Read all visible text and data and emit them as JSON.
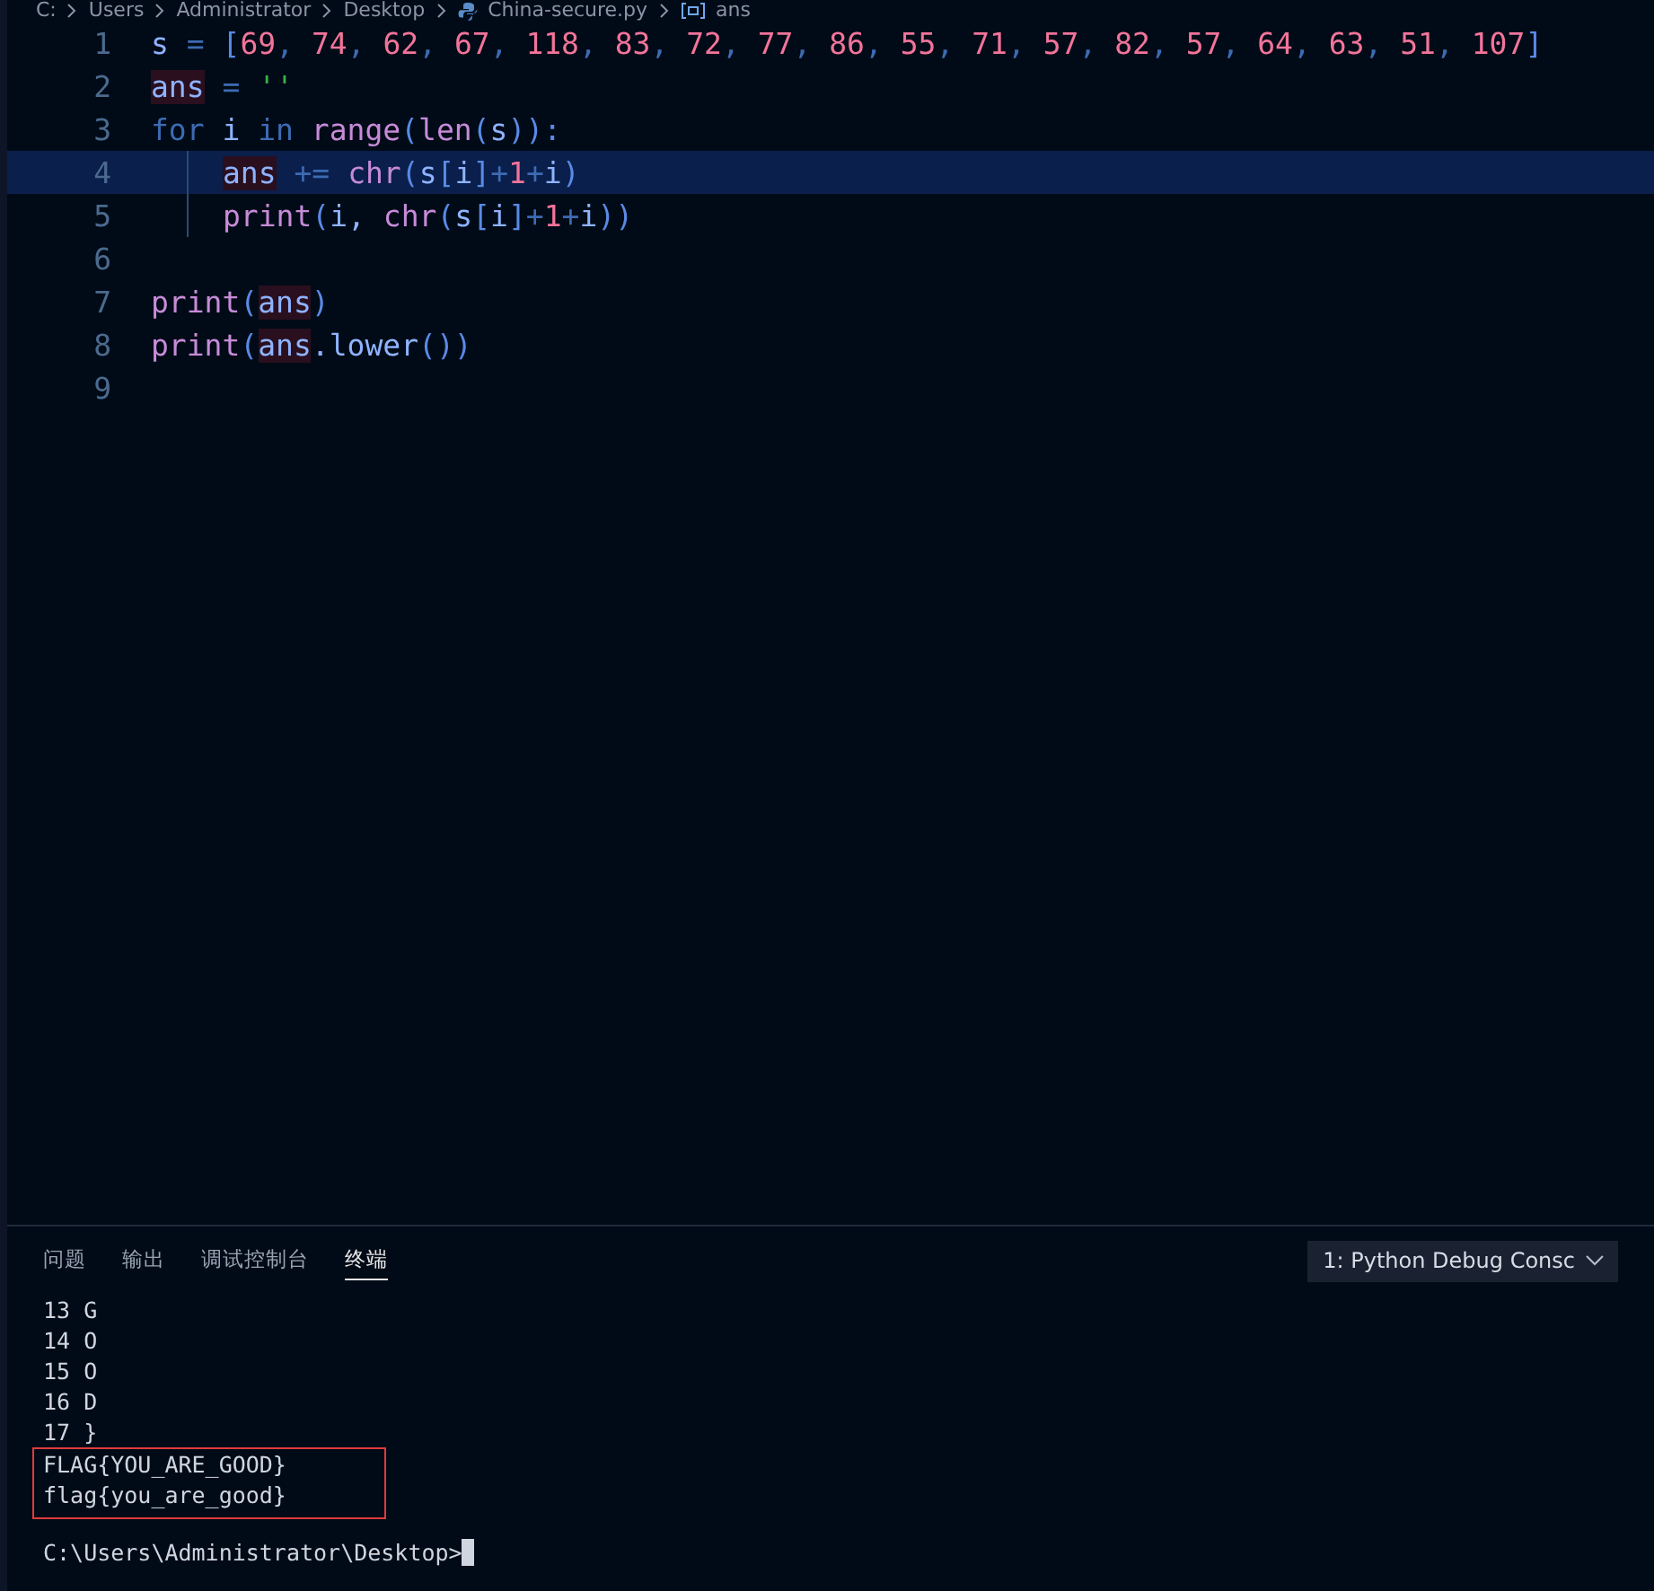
{
  "breadcrumb": [
    "C:",
    "Users",
    "Administrator",
    "Desktop",
    "China-secure.py",
    "ans"
  ],
  "editor": {
    "lines": [
      {
        "number": "1",
        "current": false,
        "indented": false,
        "tokens": [
          {
            "text": "s",
            "kind": "var"
          },
          {
            "text": " = ",
            "kind": "op"
          },
          {
            "text": "[",
            "kind": "brace"
          },
          {
            "text": "69",
            "kind": "num"
          },
          {
            "text": ", ",
            "kind": "op"
          },
          {
            "text": "74",
            "kind": "num"
          },
          {
            "text": ", ",
            "kind": "op"
          },
          {
            "text": "62",
            "kind": "num"
          },
          {
            "text": ", ",
            "kind": "op"
          },
          {
            "text": "67",
            "kind": "num"
          },
          {
            "text": ", ",
            "kind": "op"
          },
          {
            "text": "118",
            "kind": "num"
          },
          {
            "text": ", ",
            "kind": "op"
          },
          {
            "text": "83",
            "kind": "num"
          },
          {
            "text": ", ",
            "kind": "op"
          },
          {
            "text": "72",
            "kind": "num"
          },
          {
            "text": ", ",
            "kind": "op"
          },
          {
            "text": "77",
            "kind": "num"
          },
          {
            "text": ", ",
            "kind": "op"
          },
          {
            "text": "86",
            "kind": "num"
          },
          {
            "text": ", ",
            "kind": "op"
          },
          {
            "text": "55",
            "kind": "num"
          },
          {
            "text": ", ",
            "kind": "op"
          },
          {
            "text": "71",
            "kind": "num"
          },
          {
            "text": ", ",
            "kind": "op"
          },
          {
            "text": "57",
            "kind": "num"
          },
          {
            "text": ", ",
            "kind": "op"
          },
          {
            "text": "82",
            "kind": "num"
          },
          {
            "text": ", ",
            "kind": "op"
          },
          {
            "text": "57",
            "kind": "num"
          },
          {
            "text": ", ",
            "kind": "op"
          },
          {
            "text": "64",
            "kind": "num"
          },
          {
            "text": ", ",
            "kind": "op"
          },
          {
            "text": "63",
            "kind": "num"
          },
          {
            "text": ", ",
            "kind": "op"
          },
          {
            "text": "51",
            "kind": "num"
          },
          {
            "text": ", ",
            "kind": "op"
          },
          {
            "text": "107",
            "kind": "num"
          },
          {
            "text": "]",
            "kind": "brace"
          }
        ]
      },
      {
        "number": "2",
        "current": false,
        "indented": false,
        "tokens": [
          {
            "text": "ans",
            "kind": "hl"
          },
          {
            "text": " = ",
            "kind": "op"
          },
          {
            "text": "''",
            "kind": "str"
          }
        ]
      },
      {
        "number": "3",
        "current": false,
        "indented": false,
        "tokens": [
          {
            "text": "for",
            "kind": "kw"
          },
          {
            "text": " i ",
            "kind": "var"
          },
          {
            "text": "in",
            "kind": "kw"
          },
          {
            "text": " range",
            "kind": "fn"
          },
          {
            "text": "(",
            "kind": "brace"
          },
          {
            "text": "len",
            "kind": "fn"
          },
          {
            "text": "(",
            "kind": "brace"
          },
          {
            "text": "s",
            "kind": "var"
          },
          {
            "text": ")):",
            "kind": "brace"
          }
        ]
      },
      {
        "number": "4",
        "current": true,
        "indented": true,
        "tokens": [
          {
            "text": "ans",
            "kind": "hl"
          },
          {
            "text": " += ",
            "kind": "op"
          },
          {
            "text": "chr",
            "kind": "fn"
          },
          {
            "text": "(",
            "kind": "brace"
          },
          {
            "text": "s",
            "kind": "var"
          },
          {
            "text": "[",
            "kind": "brace"
          },
          {
            "text": "i",
            "kind": "var"
          },
          {
            "text": "]",
            "kind": "brace"
          },
          {
            "text": "+",
            "kind": "op"
          },
          {
            "text": "1",
            "kind": "num"
          },
          {
            "text": "+",
            "kind": "op"
          },
          {
            "text": "i",
            "kind": "var"
          },
          {
            "text": ")",
            "kind": "brace"
          }
        ]
      },
      {
        "number": "5",
        "current": false,
        "indented": true,
        "tokens": [
          {
            "text": "print",
            "kind": "fn"
          },
          {
            "text": "(",
            "kind": "brace"
          },
          {
            "text": "i, ",
            "kind": "var"
          },
          {
            "text": "chr",
            "kind": "fn"
          },
          {
            "text": "(",
            "kind": "brace"
          },
          {
            "text": "s",
            "kind": "var"
          },
          {
            "text": "[",
            "kind": "brace"
          },
          {
            "text": "i",
            "kind": "var"
          },
          {
            "text": "]",
            "kind": "brace"
          },
          {
            "text": "+",
            "kind": "op"
          },
          {
            "text": "1",
            "kind": "num"
          },
          {
            "text": "+",
            "kind": "op"
          },
          {
            "text": "i",
            "kind": "var"
          },
          {
            "text": "))",
            "kind": "brace"
          }
        ]
      },
      {
        "number": "6",
        "current": false,
        "indented": false
      },
      {
        "number": "7",
        "current": false,
        "indented": false,
        "tokens": [
          {
            "text": "print",
            "kind": "fn"
          },
          {
            "text": "(",
            "kind": "brace"
          },
          {
            "text": "ans",
            "kind": "hl"
          },
          {
            "text": ")",
            "kind": "brace"
          }
        ]
      },
      {
        "number": "8",
        "current": false,
        "indented": false,
        "tokens": [
          {
            "text": "print",
            "kind": "fn"
          },
          {
            "text": "(",
            "kind": "brace"
          },
          {
            "text": "ans",
            "kind": "hl"
          },
          {
            "text": ".lower",
            "kind": "var"
          },
          {
            "text": "())",
            "kind": "brace"
          }
        ]
      },
      {
        "number": "9",
        "current": false,
        "indented": false
      }
    ]
  },
  "panel": {
    "tabs": [
      {
        "label": "问题",
        "selected": false
      },
      {
        "label": "输出",
        "selected": false
      },
      {
        "label": "调试控制台",
        "selected": false
      },
      {
        "label": "终端",
        "selected": true
      }
    ],
    "terminal_select": "1: Python Debug Consc",
    "output": [
      "13 G",
      "14 O",
      "15 O",
      "16 D",
      "17 }"
    ],
    "highlighted_output": [
      "FLAG{YOU_ARE_GOOD}",
      "flag{you_are_good}"
    ],
    "prompt": "C:\\Users\\Administrator\\Desktop>"
  }
}
